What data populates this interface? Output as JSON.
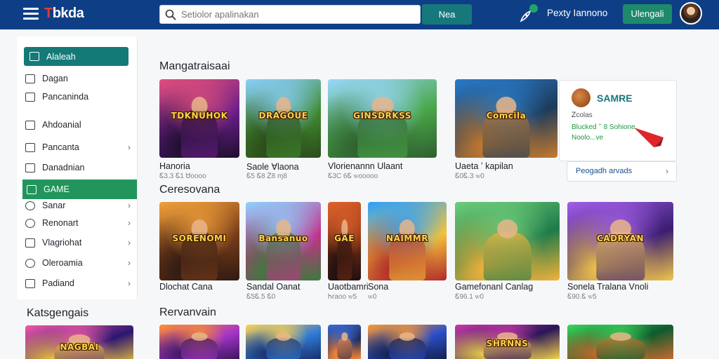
{
  "header": {
    "logo_mark": "T",
    "logo_text": "bkda",
    "search_placeholder": "Setiolor apalinakan",
    "search_button": "Nea",
    "user_name": "Pexty Iannono",
    "upload_button": "Ulengali"
  },
  "sidebar": {
    "items": [
      {
        "label": "Alaleah",
        "icon": "home-icon"
      },
      {
        "label": "Dagan",
        "icon": "page-icon"
      },
      {
        "label": "Pancaninda",
        "icon": "document-icon"
      },
      {
        "label": "Ahdoanial",
        "icon": "window-icon"
      },
      {
        "label": "Pancanta",
        "icon": "tag-icon"
      },
      {
        "label": "Danadnian",
        "icon": "chat-icon"
      },
      {
        "label": "GAME",
        "icon": "gamepad-icon"
      },
      {
        "label": "Sanar",
        "icon": "target-icon"
      },
      {
        "label": "Renonart",
        "icon": "gear-icon"
      },
      {
        "label": "Vlagriohat",
        "icon": "grid-icon"
      },
      {
        "label": "Oleroamia",
        "icon": "globe-icon"
      },
      {
        "label": "Padiand",
        "icon": "board-icon"
      }
    ],
    "categories_title": "Katsgengais"
  },
  "sections": [
    {
      "title": "Mangatraisaai",
      "cards": [
        {
          "name": "Hanoria",
          "meta": "Ꮛ3.3 Ꮛ1   Ꮜoooo",
          "art": "TDKNUHOK",
          "palette": [
            "#e04f7a",
            "#6a1f8a",
            "#1d0f2d"
          ]
        },
        {
          "name": "Saole Ɐlaona",
          "meta": "Ꮛ5 Ꮛ8  Ꮓ8 ɱ8",
          "art": "DRAGOUE",
          "palette": [
            "#8bd0ff",
            "#3f8a30",
            "#2c4a1a"
          ]
        },
        {
          "name": "Vlorienannn Ulaant",
          "meta": "Ꮛ3C 6Ꮛ  ꮃooooo",
          "art": "GINSDRKSS",
          "palette": [
            "#9ad7ff",
            "#4aa84a",
            "#2f5e2f"
          ]
        },
        {
          "name": "Uaeta ʼ kapilan",
          "meta": "Ꮛ0Ꮛ.3 ꮃ0",
          "art": "Comcila",
          "palette": [
            "#2a7bc9",
            "#1c3b5a",
            "#c77a2e"
          ]
        }
      ]
    },
    {
      "title": "Ceresovana",
      "cards": [
        {
          "name": "Dlochat Cana",
          "meta": "",
          "art": "SORENOMI",
          "palette": [
            "#f2a13a",
            "#7a3d1a",
            "#2e1a12"
          ]
        },
        {
          "name": "Sandal Oanat",
          "meta": "Ꮛ5Ꮛ.5 Ꮛ0",
          "art": "Bansanuo",
          "palette": [
            "#8ed3ff",
            "#c4318a",
            "#3c7a3c"
          ]
        },
        {
          "name": "Uaotbamri",
          "meta": "Ꮒraoo ꮃ5",
          "art": "GAE",
          "palette": [
            "#e2622a",
            "#6e2a12",
            "#201010"
          ]
        },
        {
          "name": "Sona",
          "meta": "ꮃ0",
          "art": "NAIMMR",
          "palette": [
            "#2aa0ff",
            "#f5c33a",
            "#b02a2a"
          ]
        },
        {
          "name": "Gamefonanl Canlag",
          "meta": "Ꮛ96.1 ꮃ0",
          "art": "",
          "palette": [
            "#6fcf7a",
            "#1e7a4a",
            "#f5b23a"
          ]
        },
        {
          "name": "Sonela Tralana Vnoli",
          "meta": "Ꮛ90.Ꮛ ꮃ5",
          "art": "CADRYAN",
          "palette": [
            "#a35ee8",
            "#3a1d70",
            "#f2c64a"
          ]
        }
      ]
    },
    {
      "title": "Rervanvain",
      "cards": [
        {
          "art": "",
          "palette": [
            "#ff8f2e",
            "#a335c9",
            "#3b1760"
          ]
        },
        {
          "art": "",
          "palette": [
            "#ffd34f",
            "#2e7ad6",
            "#1a2f6b"
          ]
        },
        {
          "art": "",
          "palette": [
            "#3b6ad6",
            "#1c2a55",
            "#ff8a3a"
          ]
        },
        {
          "art": "",
          "palette": [
            "#ff9a2e",
            "#2b4ec9",
            "#13214e"
          ]
        },
        {
          "art": "SHRNNS",
          "palette": [
            "#c93aa8",
            "#2a1658",
            "#f2d24a"
          ]
        },
        {
          "art": "",
          "palette": [
            "#3bd65a",
            "#0f5a2e",
            "#c96a2e"
          ]
        }
      ]
    }
  ],
  "promo": {
    "title": "SAMRE",
    "line1": "Ꮓcolas",
    "line2": "Blucked ʼʼ 8 Sohione",
    "line3": "Noolo...ve",
    "link": "Peogadh arvads"
  },
  "side_banner": {
    "art": "NAGBAI",
    "palette": [
      "#f25aa8",
      "#2a1770",
      "#ffcf3a"
    ]
  },
  "colors": {
    "topbar": "#0e3f86",
    "accent_teal": "#137a78",
    "accent_green": "#22955c"
  }
}
